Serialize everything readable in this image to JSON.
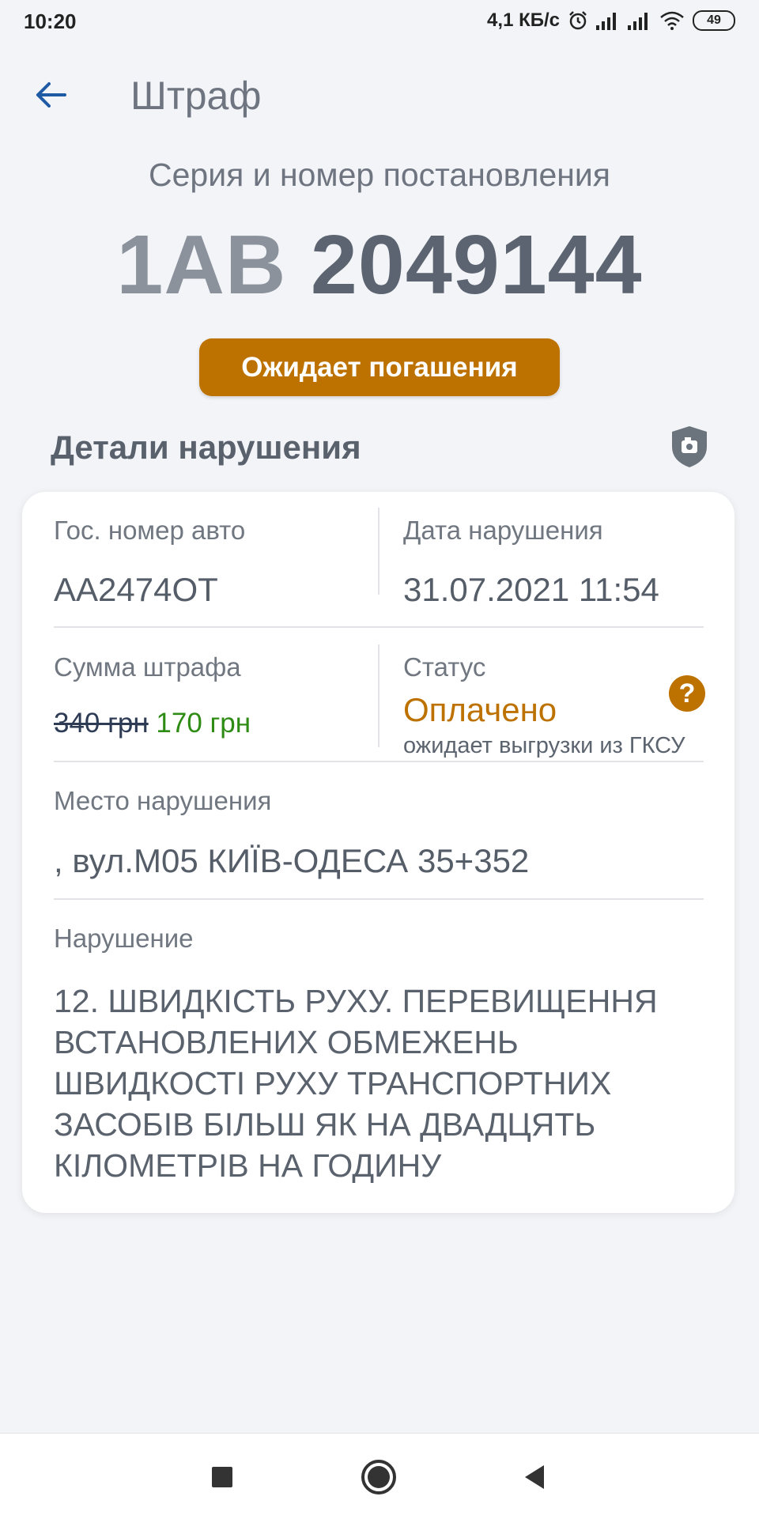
{
  "status_bar": {
    "time": "10:20",
    "speed": "4,1 КБ/с",
    "battery": "49",
    "icons": [
      "alarm-icon",
      "signal-icon",
      "signal-icon",
      "wifi-icon",
      "battery-icon"
    ]
  },
  "app_bar": {
    "title": "Штраф",
    "back_icon": "arrow-left-icon"
  },
  "ticket": {
    "series_label": "Серия и номер постановления",
    "series": "1АВ",
    "number": "2049144",
    "status_badge": "Ожидает погашения"
  },
  "details": {
    "title": "Детали нарушения",
    "shield_icon": "shield-camera-icon",
    "plate_label": "Гос. номер авто",
    "plate_value": "AA2474OT",
    "date_label": "Дата нарушения",
    "date_value": "31.07.2021 11:54",
    "amount_label": "Сумма штрафа",
    "amount_old": "340 грн",
    "amount_new": "170 грн",
    "status_label": "Статус",
    "status_value": "Оплачено",
    "status_note": "ожидает выгрузки из ГКСУ",
    "help_icon": "?",
    "place_label": "Место нарушения",
    "place_value": ", вул.М05 КИЇВ-ОДЕСА 35+352",
    "violation_label": "Нарушение",
    "violation_value": "12. ШВИДКІСТЬ РУХУ. ПЕРЕВИЩЕННЯ ВСТАНОВЛЕНИХ ОБМЕЖЕНЬ ШВИДКОСТІ РУХУ ТРАНСПОРТНИХ ЗАСОБІВ БІЛЬШ ЯК НА ДВАДЦЯТЬ КІЛОМЕТРІВ НА ГОДИНУ"
  },
  "nav_bar": {
    "icons": [
      "square-icon",
      "circle-icon",
      "triangle-back-icon"
    ]
  },
  "colors": {
    "accent": "#bd7200",
    "paid_green": "#2e8b14",
    "background": "#f3f4f7",
    "back_arrow": "#1f5aa5"
  }
}
